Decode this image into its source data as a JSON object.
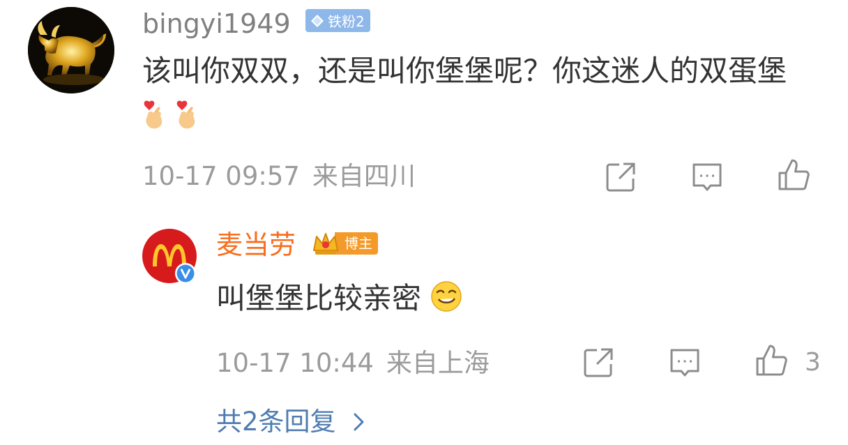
{
  "main_comment": {
    "username": "bingyi1949",
    "badge": "铁粉2",
    "content": "该叫你双双，还是叫你堡堡呢？你这迷人的双蛋堡",
    "emojis": [
      "finger-heart-emoji",
      "finger-heart-emoji"
    ],
    "time": "10-17 09:57",
    "location": "来自四川",
    "actions": [
      "share-icon",
      "comment-icon",
      "like-icon"
    ]
  },
  "reply": {
    "username": "麦当劳",
    "badge": "博主",
    "content": "叫堡堡比较亲密",
    "emojis": [
      "smirk-emoji"
    ],
    "time": "10-17 10:44",
    "location": "来自上海",
    "like_count": "3",
    "actions": [
      "share-icon",
      "comment-icon",
      "like-icon"
    ]
  },
  "more_replies": {
    "label": "共2条回复"
  },
  "colors": {
    "username_main": "#7f7f7f",
    "username_blogger": "#f86e1f",
    "meta_text": "#9b9b9b",
    "link_blue": "#4f7cb0",
    "badge_fan_bg": "#8eb8ea",
    "badge_blogger_bg": "#f39a2a",
    "mcd_red": "#d71a1b",
    "mcd_yellow": "#ffc72c"
  }
}
